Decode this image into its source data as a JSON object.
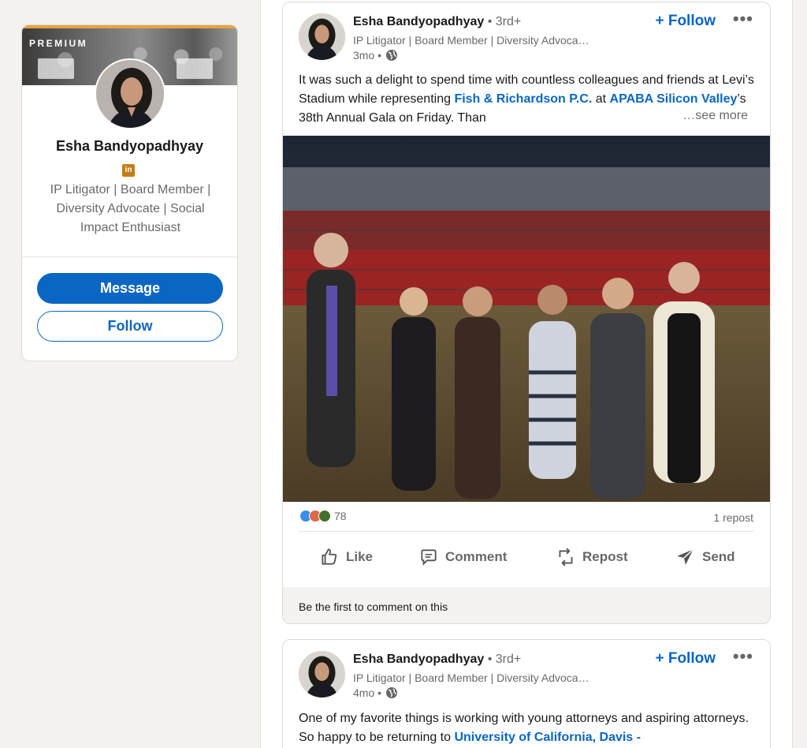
{
  "profile": {
    "premium_label": "PREMIUM",
    "name": "Esha Bandyopadhyay",
    "badge_icon": "linkedin-icon",
    "headline": "IP Litigator | Board Member | Diversity Advocate | Social Impact Enthusiast",
    "message_label": "Message",
    "follow_label": "Follow"
  },
  "posts": [
    {
      "author": "Esha Bandyopadhyay",
      "degree": " • 3rd+",
      "headline": "IP Litigator | Board Member | Diversity Advoca…",
      "time": "3mo •",
      "follow_label": "+ Follow",
      "more_label": "•••",
      "text_1": "It was such a delight to spend time with countless colleagues and friends at Levi’s Stadium while representing ",
      "link_1": "Fish & Richardson P.C.",
      "text_2": " at ",
      "link_2": "APABA Silicon Valley",
      "text_3": "’s 38th Annual Gala on Friday. Than",
      "see_more": "…see more",
      "reaction_count": "78",
      "repost_count": "1 repost",
      "actions": {
        "like": "Like",
        "comment": "Comment",
        "repost": "Repost",
        "send": "Send"
      },
      "comment_prompt": "Be the first to comment on this"
    },
    {
      "author": "Esha Bandyopadhyay",
      "degree": " • 3rd+",
      "headline": "IP Litigator | Board Member | Diversity Advoca…",
      "time": "4mo •",
      "follow_label": "+ Follow",
      "more_label": "•••",
      "text_1": "One of my favorite things is working with young attorneys and aspiring attorneys. So happy to be returning to ",
      "link_1": "University of California, Davis -"
    }
  ],
  "colors": {
    "accent": "#0a66c2",
    "premium": "#e7a33e",
    "badge": "#c37d16"
  }
}
